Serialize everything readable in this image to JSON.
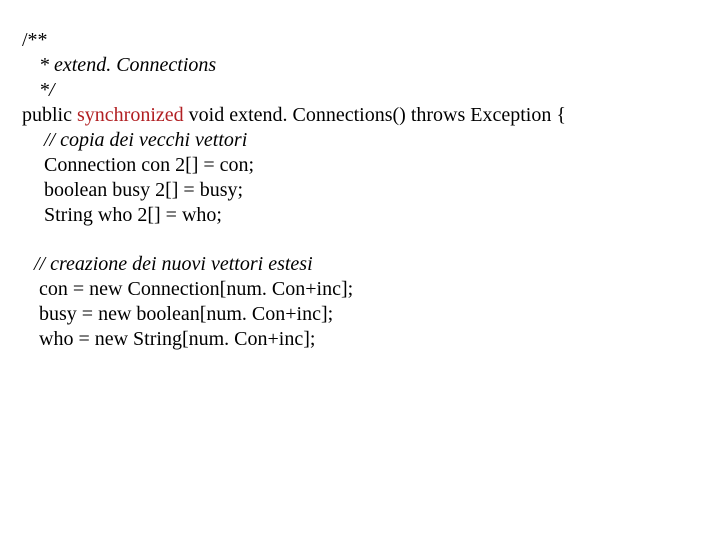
{
  "code": {
    "l1": "/**",
    "l2": " * extend. Connections",
    "l3": " */ ",
    "l4a": "public ",
    "l4kw": "synchronized",
    "l4b": " void extend. Connections() throws Exception {",
    "l5": "  // copia dei vecchi vettori",
    "l6": "  Connection con 2[] = con;",
    "l7": "  boolean busy 2[] = busy;",
    "l8": "  String who 2[] = who;",
    "l9": "// creazione dei nuovi vettori estesi",
    "l10": " con = new Connection[num. Con+inc];",
    "l11": " busy = new boolean[num. Con+inc];",
    "l12": " who = new String[num. Con+inc];"
  }
}
